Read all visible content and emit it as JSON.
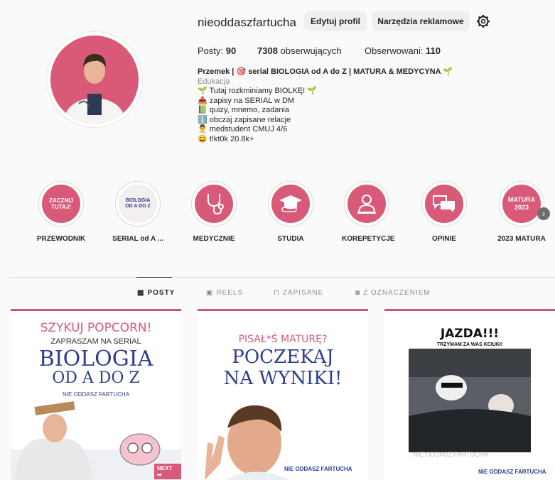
{
  "profile": {
    "username": "nieoddaszfartucha",
    "edit_label": "Edytuj profil",
    "ads_label": "Narzędzia reklamowe",
    "posts_label": "Posty:",
    "posts_count": "90",
    "followers_count": "7308",
    "followers_label": "obserwujących",
    "following_label": "Obserwowani:",
    "following_count": "110"
  },
  "bio": {
    "name": "Przemek | 🎯 serial BIOLOGIA od A do Z | MATURA & MEDYCYNA 🌱",
    "category": "Edukacja",
    "lines": [
      "🌱 Tutaj rozkminiamy BIOLKĘ! 🌱",
      "📤 zapisy na SERIAL w DM",
      "📗 quizy, mnemo, zadania",
      "ℹ️ obczaj zapisane relacje",
      "👨‍⚕️ medstudent CMUJ 4/6",
      "😀 t!kt0k 20.8k+"
    ]
  },
  "highlights": [
    {
      "label": "PRZEWODNIK",
      "inner": "ZACZNIJ TUTAJ!"
    },
    {
      "label": "SERIAL od A ...",
      "inner": "BIOLOGIA OD A DO Z"
    },
    {
      "label": "MEDYCZNIE",
      "inner": ""
    },
    {
      "label": "STUDIA",
      "inner": ""
    },
    {
      "label": "KOREPETYCJE",
      "inner": ""
    },
    {
      "label": "OPINIE",
      "inner": ""
    },
    {
      "label": "2023 MATURA",
      "inner": "MATURA 2023"
    }
  ],
  "tabs": [
    {
      "label": "POSTY"
    },
    {
      "label": "REELS"
    },
    {
      "label": "ZAPISANE"
    },
    {
      "label": "Z OZNACZENIEM"
    }
  ],
  "posts": [
    {
      "line1": "SZYKUJ POPCORN!",
      "line2": "ZAPRASZAM NA SERIAL",
      "line3": "BIOLOGIA",
      "line4": "OD A DO Z",
      "brand": "NIE ODDASZ FARTUCHA",
      "badge": "NEXT ➡"
    },
    {
      "line1": "PISAŁ*Ś MATURĘ?",
      "line2": "POCZEKAJ",
      "line3": "NA WYNIKI!",
      "brand": "NIE ODDASZ FARTUCHA"
    },
    {
      "line1": "JAZDA!!!",
      "line2": "TRZYMAM ZA WAS KCIUKI!",
      "brand": "NIE ODDASZ FARTUCHA",
      "watermark": "NIE ODDASZ FARTUCHA"
    }
  ],
  "colors": {
    "brand_pink": "#d95a78",
    "accent_blue": "#2c3e8f"
  }
}
